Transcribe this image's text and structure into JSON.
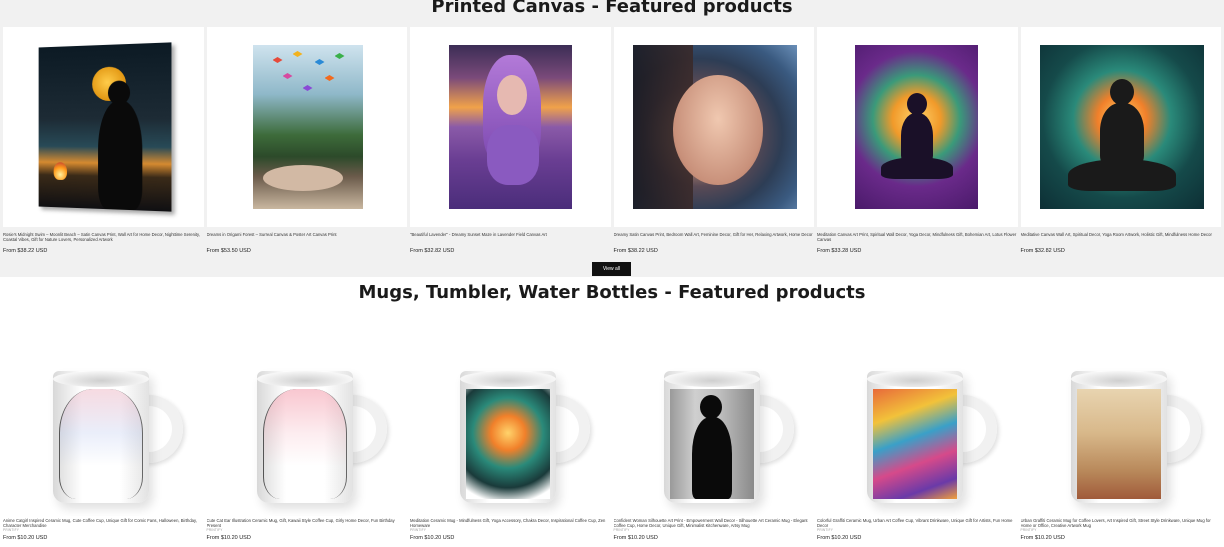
{
  "sections": [
    {
      "title": "Printed Canvas - Featured products",
      "view_all": "View all",
      "products": [
        {
          "title": "Rosie's Midnight Swim – Moonlit Beach – Satin Canvas Print, Wall Art for Home Decor, Nighttime Serenity, Coastal Vibes, Gift for Nature Lovers, Personalized Artwork",
          "price": "From $38.22 USD"
        },
        {
          "title": "Dreams in Origami Forest – Surreal Canvas & Poster Art Canvas Print",
          "price": "From $53.50 USD"
        },
        {
          "title": "\"Beautiful Lavender\" - Dreamy Sunset Maze in Lavender Field Canvas Art",
          "price": "From $32.82 USD"
        },
        {
          "title": "Dreamy Satin Canvas Print, Bedroom Wall Art, Feminine Decor, Gift for Her, Relaxing Artwork, Home Decor",
          "price": "From $38.22 USD"
        },
        {
          "title": "Meditation Canvas Art Print, Spiritual Wall Decor, Yoga Decor, Mindfulness Gift, Bohemian Art, Lotus Flower Canvas",
          "price": "From $33.28 USD"
        },
        {
          "title": "Meditative Canvas Wall Art, Spiritual Decor, Yoga Room Artwork, Holistic Gift, Mindfulness Home Decor",
          "price": "From $32.82 USD"
        }
      ]
    },
    {
      "title": "Mugs, Tumbler, Water Bottles - Featured products",
      "products": [
        {
          "title": "Anime Catgirl Inspired Ceramic Mug, Cute Coffee Cup, Unique Gift for Comic Fans, Halloween, Birthday, Character Merchandise",
          "vendor": "PRINTIFY",
          "price": "From $10.20 USD"
        },
        {
          "title": "Cute Cat Ear Illustration Ceramic Mug, Gift, Kawaii Style Coffee Cup, Girly Home Decor, Fun Birthday Present",
          "vendor": "PRINTIFY",
          "price": "From $10.20 USD"
        },
        {
          "title": "Meditation Ceramic Mug - Mindfulness Gift, Yoga Accessory, Chakra Decor, Inspirational Coffee Cup, Zen Homeware",
          "vendor": "PRINTIFY",
          "price": "From $10.20 USD"
        },
        {
          "title": "Confident Woman Silhouette Art Print - Empowerment Wall Decor - Silhouette Art Ceramic Mug - Elegant Coffee Cup, Home Decor, Unique Gift, Minimalist Kitchenware, Artsy Mug",
          "vendor": "PRINTIFY",
          "price": "From $10.20 USD"
        },
        {
          "title": "Colorful Graffiti Ceramic Mug, Urban Art Coffee Cup, Vibrant Drinkware, Unique Gift for Artists, Fun Home Decor",
          "vendor": "PRINTIFY",
          "price": "From $10.20 USD"
        },
        {
          "title": "Urban Graffiti Ceramic Mug for Coffee Lovers, Art Inspired Gift, Street Style Drinkware, Unique Mug for Home or Office, Creative Artwork Mug",
          "vendor": "PRINTIFY",
          "price": "From $10.20 USD"
        }
      ]
    }
  ]
}
